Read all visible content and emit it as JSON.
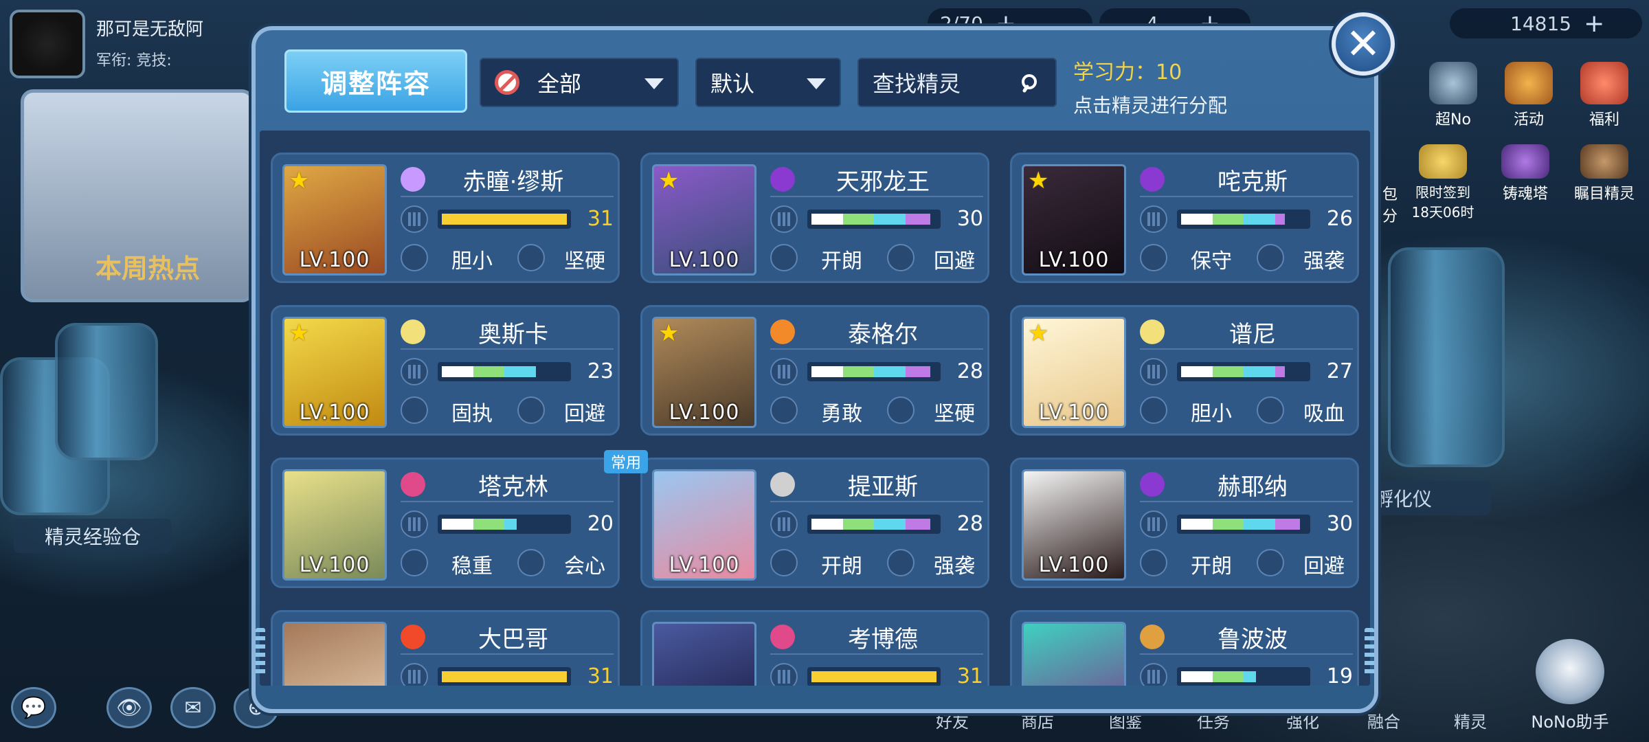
{
  "player": {
    "name": "那可是无敌阿",
    "sub": "军衔:  竞技:"
  },
  "resources": [
    {
      "value": "2/70",
      "plus": "+"
    },
    {
      "value": "4",
      "plus": "+"
    },
    {
      "value": "14815",
      "plus": "+"
    }
  ],
  "background": {
    "hot_week": "本周热点",
    "exp_cabin": "精灵经验仓",
    "hatcher": "孵化仪",
    "right_nav": [
      "超No",
      "活动",
      "福利",
      "限时签到\n18天06时",
      "铸魂塔",
      "瞩目精灵"
    ],
    "bottom_nav": [
      "好友",
      "商店",
      "图鉴",
      "任务",
      "强化",
      "融合",
      "精灵"
    ],
    "nono": "NoNo助手",
    "left_partial": [
      "包",
      "分"
    ]
  },
  "panel": {
    "adjust_button": "调整阵容",
    "filter": {
      "selected": "全部"
    },
    "sort": {
      "selected": "默认"
    },
    "search": {
      "placeholder": "查找精灵"
    },
    "learn_power_label": "学习力：10",
    "learn_hint": "点击精灵进行分配",
    "close": "✕"
  },
  "spirits": [
    {
      "name": "赤瞳·缪斯",
      "level": "LV.100",
      "value": "31",
      "bar": "gold",
      "traits": [
        "胆小",
        "坚硬"
      ],
      "star": true,
      "badge": ""
    },
    {
      "name": "天邪龙王",
      "level": "LV.100",
      "value": "30",
      "bar": "multi4",
      "traits": [
        "开朗",
        "回避"
      ],
      "star": true,
      "badge": ""
    },
    {
      "name": "咤克斯",
      "level": "LV.100",
      "value": "26",
      "bar": "multi4s",
      "traits": [
        "保守",
        "强袭"
      ],
      "star": true,
      "badge": ""
    },
    {
      "name": "奥斯卡",
      "level": "LV.100",
      "value": "23",
      "bar": "multi3",
      "traits": [
        "固执",
        "回避"
      ],
      "star": true,
      "badge": ""
    },
    {
      "name": "泰格尔",
      "level": "LV.100",
      "value": "28",
      "bar": "multi4",
      "traits": [
        "勇敢",
        "坚硬"
      ],
      "star": true,
      "badge": ""
    },
    {
      "name": "谱尼",
      "level": "LV.100",
      "value": "27",
      "bar": "multi4s",
      "traits": [
        "胆小",
        "吸血"
      ],
      "star": true,
      "badge": ""
    },
    {
      "name": "塔克林",
      "level": "LV.100",
      "value": "20",
      "bar": "multi3s",
      "traits": [
        "稳重",
        "会心"
      ],
      "star": false,
      "badge": "常用"
    },
    {
      "name": "提亚斯",
      "level": "LV.100",
      "value": "28",
      "bar": "multi4",
      "traits": [
        "开朗",
        "强袭"
      ],
      "star": false,
      "badge": ""
    },
    {
      "name": "赫耶纳",
      "level": "LV.100",
      "value": "30",
      "bar": "multi4",
      "traits": [
        "开朗",
        "回避"
      ],
      "star": false,
      "badge": ""
    },
    {
      "name": "大巴哥",
      "level": "",
      "value": "31",
      "bar": "gold",
      "traits": [],
      "star": false,
      "badge": ""
    },
    {
      "name": "考博德",
      "level": "",
      "value": "31",
      "bar": "gold",
      "traits": [],
      "star": false,
      "badge": ""
    },
    {
      "name": "鲁波波",
      "level": "",
      "value": "19",
      "bar": "multi3s",
      "traits": [],
      "star": false,
      "badge": ""
    }
  ],
  "colors": {
    "gold": "#f8cf33",
    "white": "#ffffff",
    "green": "#8fe07a",
    "cyan": "#5fd7ec",
    "purple": "#c07ae6"
  }
}
